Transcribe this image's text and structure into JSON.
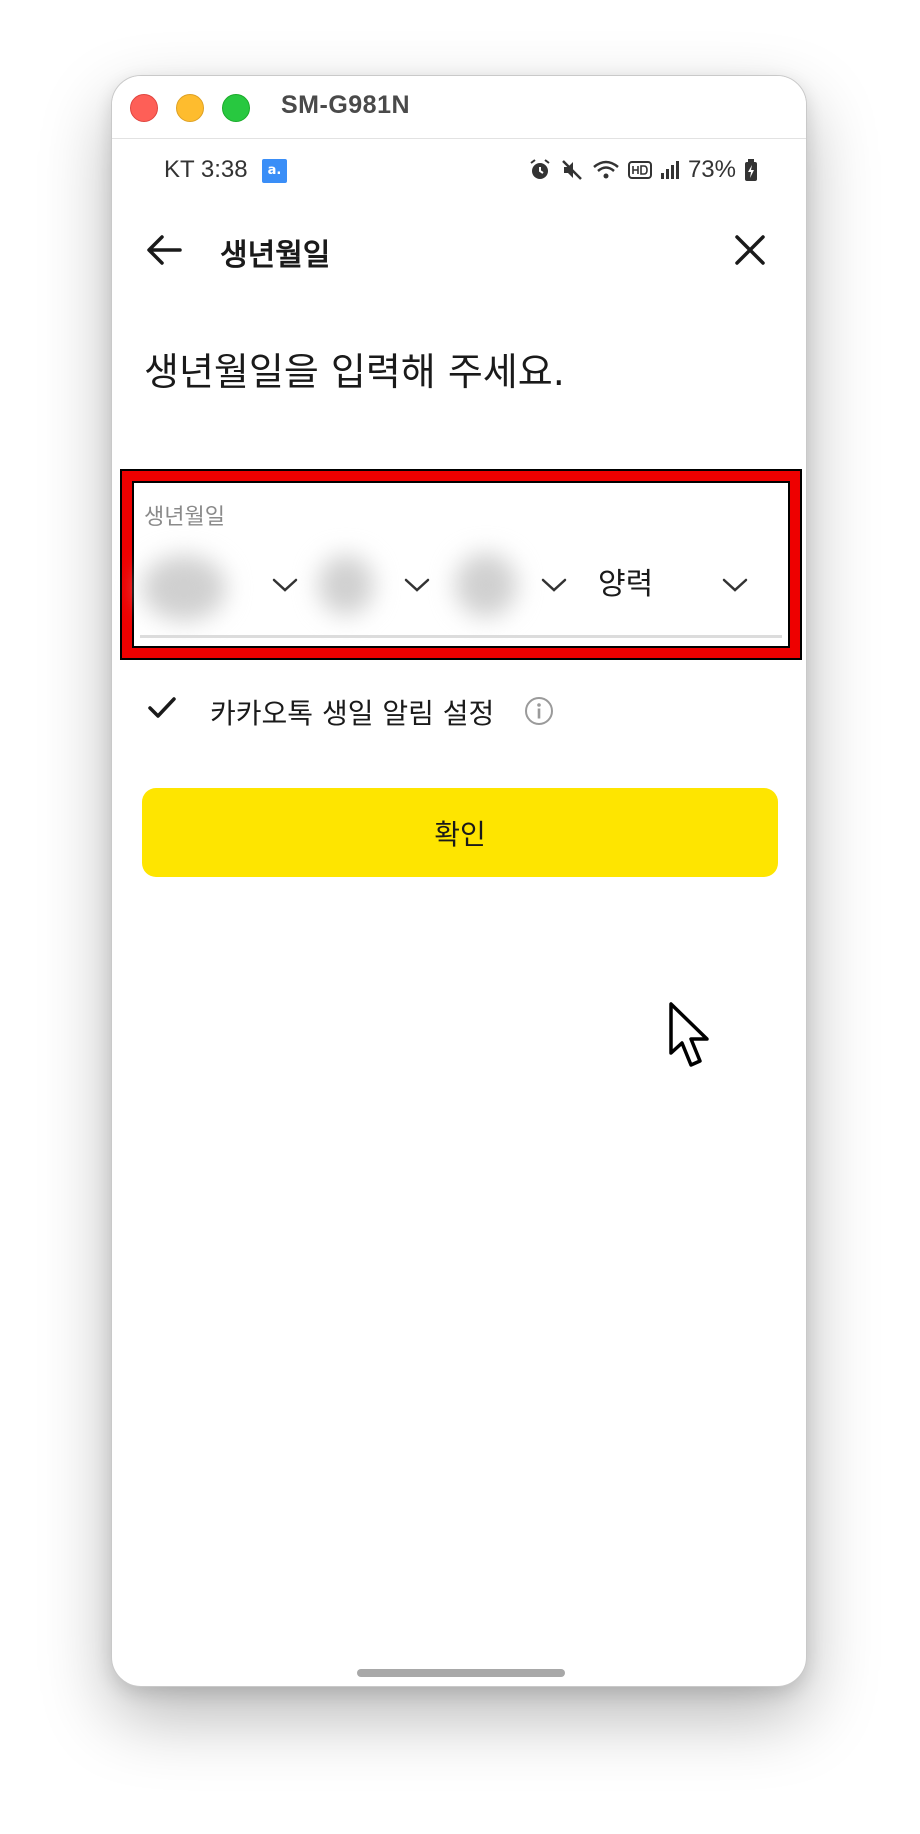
{
  "window": {
    "title": "SM-G981N"
  },
  "statusbar": {
    "carrier_time": "KT 3:38",
    "notif_badge": "a.",
    "battery": "73%",
    "icons": [
      "alarm-icon",
      "mute-icon",
      "wifi-icon",
      "hd-icon",
      "signal-icon",
      "battery-icon"
    ]
  },
  "header": {
    "title": "생년월일",
    "back_icon": "arrow-left-icon",
    "close_icon": "close-icon"
  },
  "prompt": "생년월일을 입력해 주세요.",
  "birth_field": {
    "label": "생년월일",
    "year": "",
    "month": "",
    "day": "",
    "calendar_type": "양력",
    "highlight_color": "#ee0000"
  },
  "birthday_alarm": {
    "label": "카카오톡 생일 알림 설정",
    "checked": true
  },
  "confirm_button": {
    "label": "확인",
    "color": "#fee500"
  }
}
